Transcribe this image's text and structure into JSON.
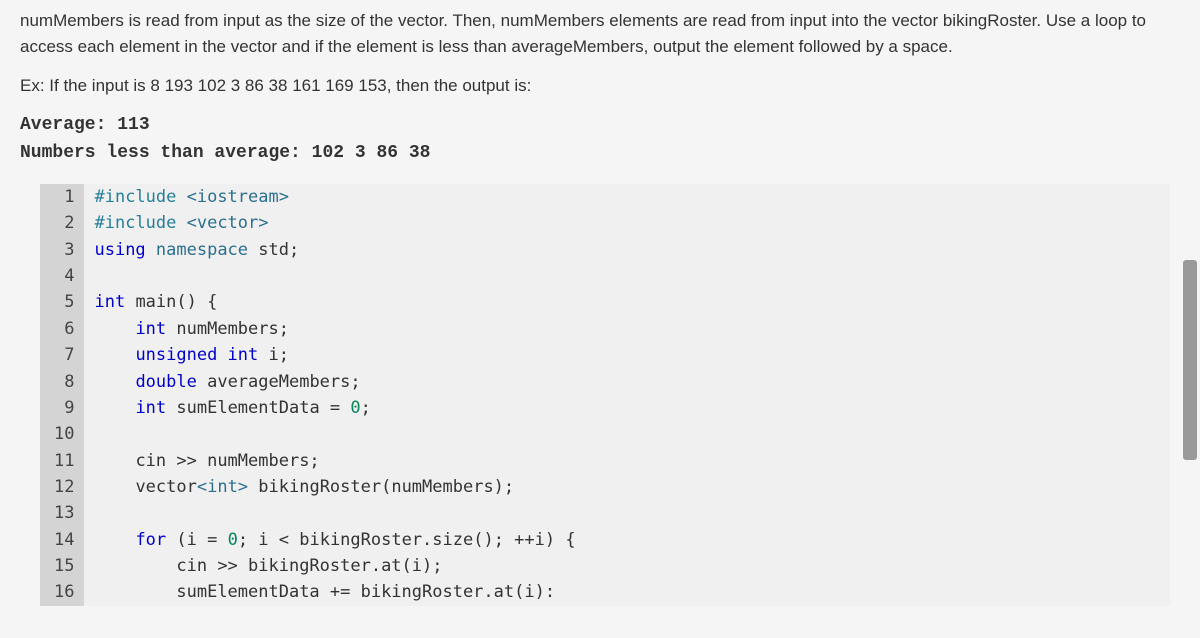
{
  "problem": {
    "paragraph": "numMembers is read from input as the size of the vector. Then, numMembers elements are read from input into the vector bikingRoster. Use a loop to access each element in the vector and if the element is less than averageMembers, output the element followed by a space.",
    "example_intro": "Ex: If the input is 8 193 102 3 86 38 161 169 153, then the output is:",
    "output_line1": "Average: 113",
    "output_line2": "Numbers less than average: 102 3 86 38"
  },
  "code": {
    "lines": [
      {
        "n": 1,
        "t": "include1"
      },
      {
        "n": 2,
        "t": "include2"
      },
      {
        "n": 3,
        "t": "using"
      },
      {
        "n": 4,
        "t": "blank"
      },
      {
        "n": 5,
        "t": "main"
      },
      {
        "n": 6,
        "t": "decl_num"
      },
      {
        "n": 7,
        "t": "decl_i"
      },
      {
        "n": 8,
        "t": "decl_avg"
      },
      {
        "n": 9,
        "t": "decl_sum"
      },
      {
        "n": 10,
        "t": "blank"
      },
      {
        "n": 11,
        "t": "cin_num"
      },
      {
        "n": 12,
        "t": "vec"
      },
      {
        "n": 13,
        "t": "blank"
      },
      {
        "n": 14,
        "t": "for"
      },
      {
        "n": 15,
        "t": "cin_at"
      },
      {
        "n": 16,
        "t": "sum_add"
      }
    ],
    "tokens": {
      "include1_pre": "#include ",
      "include1_hdr": "<iostream>",
      "include2_pre": "#include ",
      "include2_hdr": "<vector>",
      "using_kw": "using",
      "using_ns": " namespace",
      "using_std": " std",
      "using_semi": ";",
      "main_int": "int",
      "main_rest": " main() {",
      "decl_num_type": "int",
      "decl_num_rest": " numMembers;",
      "decl_i_uns": "unsigned int",
      "decl_i_rest": " i;",
      "decl_avg_type": "double",
      "decl_avg_rest": " averageMembers;",
      "decl_sum_type": "int",
      "decl_sum_mid": " sumElementData = ",
      "decl_sum_zero": "0",
      "decl_sum_semi": ";",
      "cin_num": "cin >> numMembers;",
      "vec_type": "vector",
      "vec_ang": "<int>",
      "vec_rest": " bikingRoster(numMembers);",
      "for_kw": "for",
      "for_mid1": " (i = ",
      "for_zero": "0",
      "for_mid2": "; i < bikingRoster.size(); ++i) {",
      "cin_at": "cin >> bikingRoster.at(i);",
      "sum_add": "sumElementData += bikingRoster.at(i):"
    },
    "indent1": "    ",
    "indent2": "        "
  }
}
